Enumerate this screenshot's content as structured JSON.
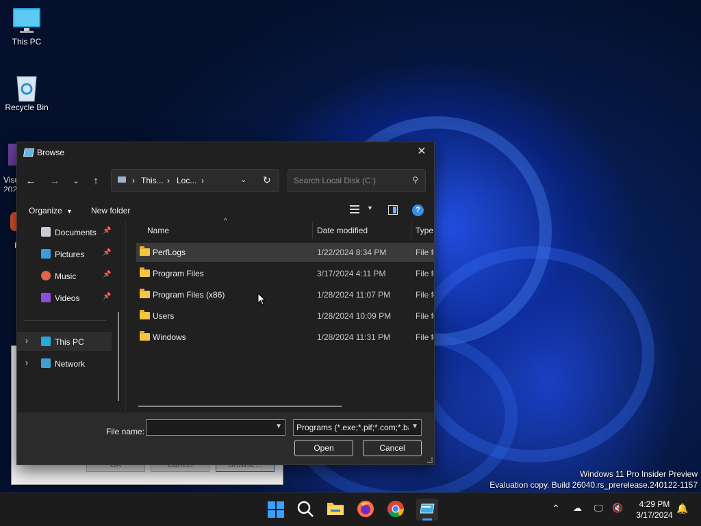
{
  "desktop": {
    "icons": [
      {
        "label": "This PC"
      },
      {
        "label": "Recycle Bin"
      },
      {
        "label": "Visu\n202"
      },
      {
        "label": "F"
      }
    ]
  },
  "background_dialog": {
    "buttons": [
      "OK",
      "Cancel",
      "Browse..."
    ]
  },
  "dialog": {
    "title": "Browse",
    "address": {
      "segments": [
        "This...",
        "Loc..."
      ]
    },
    "search_placeholder": "Search Local Disk (C:)",
    "toolbar": {
      "organize": "Organize",
      "new_folder": "New folder"
    },
    "nav": [
      {
        "label": "Documents",
        "pinned": true
      },
      {
        "label": "Pictures",
        "pinned": true
      },
      {
        "label": "Music",
        "pinned": true
      },
      {
        "label": "Videos",
        "pinned": true
      },
      {
        "label": "This PC",
        "selected": true
      },
      {
        "label": "Network"
      }
    ],
    "columns": {
      "name": "Name",
      "date": "Date modified",
      "type": "Type"
    },
    "rows": [
      {
        "name": "PerfLogs",
        "date": "1/22/2024 8:34 PM",
        "type": "File fo"
      },
      {
        "name": "Program Files",
        "date": "3/17/2024 4:11 PM",
        "type": "File fo"
      },
      {
        "name": "Program Files (x86)",
        "date": "1/28/2024 11:07 PM",
        "type": "File fo"
      },
      {
        "name": "Users",
        "date": "1/28/2024 10:09 PM",
        "type": "File fo"
      },
      {
        "name": "Windows",
        "date": "1/28/2024 11:31 PM",
        "type": "File fo"
      }
    ],
    "filename_label": "File name:",
    "filename_value": "",
    "filter_value": "Programs (*.exe;*.pif;*.com;*.ba",
    "open_label": "Open",
    "cancel_label": "Cancel"
  },
  "watermark": {
    "line1": "Windows 11 Pro Insider Preview",
    "line2": "Evaluation copy. Build 26040.rs_prerelease.240122-1157"
  },
  "taskbar": {
    "time": "4:29 PM",
    "date": "3/17/2024",
    "apps": [
      "start-icon",
      "search-icon",
      "file-explorer-icon",
      "firefox-icon",
      "chrome-icon",
      "active-app-icon"
    ],
    "tray": [
      "chevron-up-icon",
      "cloud-off-icon",
      "network-icon",
      "volume-muted-icon",
      "notification-bell-icon"
    ]
  },
  "colors": {
    "accent": "#0078d4",
    "dialog_bg": "#202020",
    "folder": "#f6c343"
  }
}
